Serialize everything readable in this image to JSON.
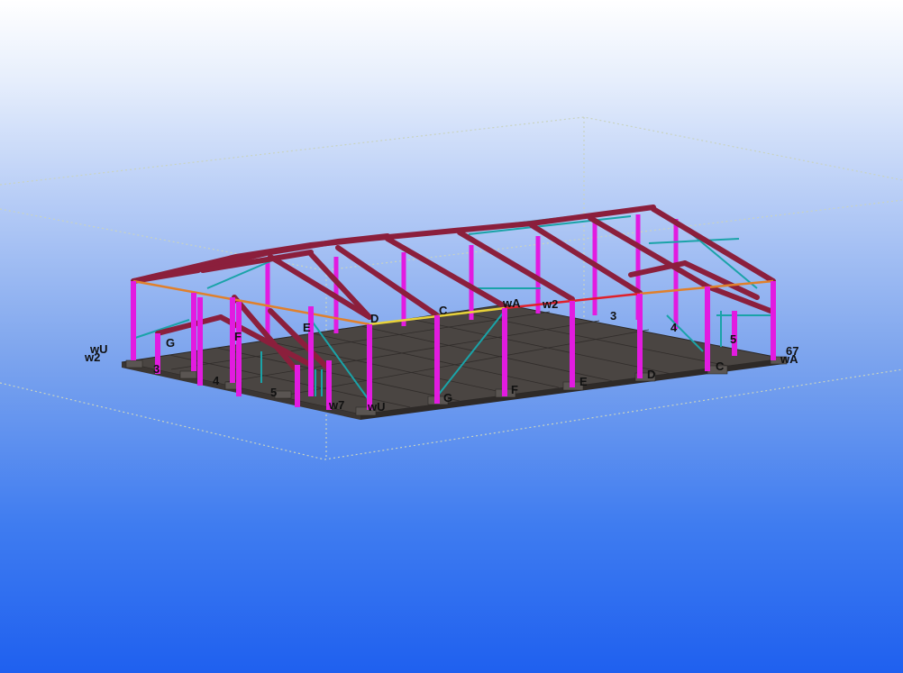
{
  "viewport": {
    "background_top": "#ffffff",
    "background_bottom": "#1f60ef"
  },
  "colors": {
    "column": "#e21be0",
    "rafter": "#8b1f3c",
    "brace": "#1aa3a8",
    "slab": "#4a4542",
    "grid_line": "#3a3a3a",
    "work_area": "#c8d0c0",
    "beam_orange": "#e0802c",
    "beam_yellow": "#e8d23a",
    "beam_red": "#e0202a"
  },
  "grid_labels": {
    "left_front": [
      "G",
      "F",
      "E",
      "D"
    ],
    "left_numbers": [
      "3",
      "4",
      "5"
    ],
    "left_corner": [
      "wU",
      "w2"
    ],
    "front_corner": [
      "w7",
      "wU"
    ],
    "front_letters": [
      "G",
      "F",
      "E",
      "D",
      "C"
    ],
    "back_top": [
      "C",
      "wA",
      "w2",
      "3",
      "4",
      "5"
    ],
    "right_corner": [
      "67",
      "wA"
    ]
  }
}
